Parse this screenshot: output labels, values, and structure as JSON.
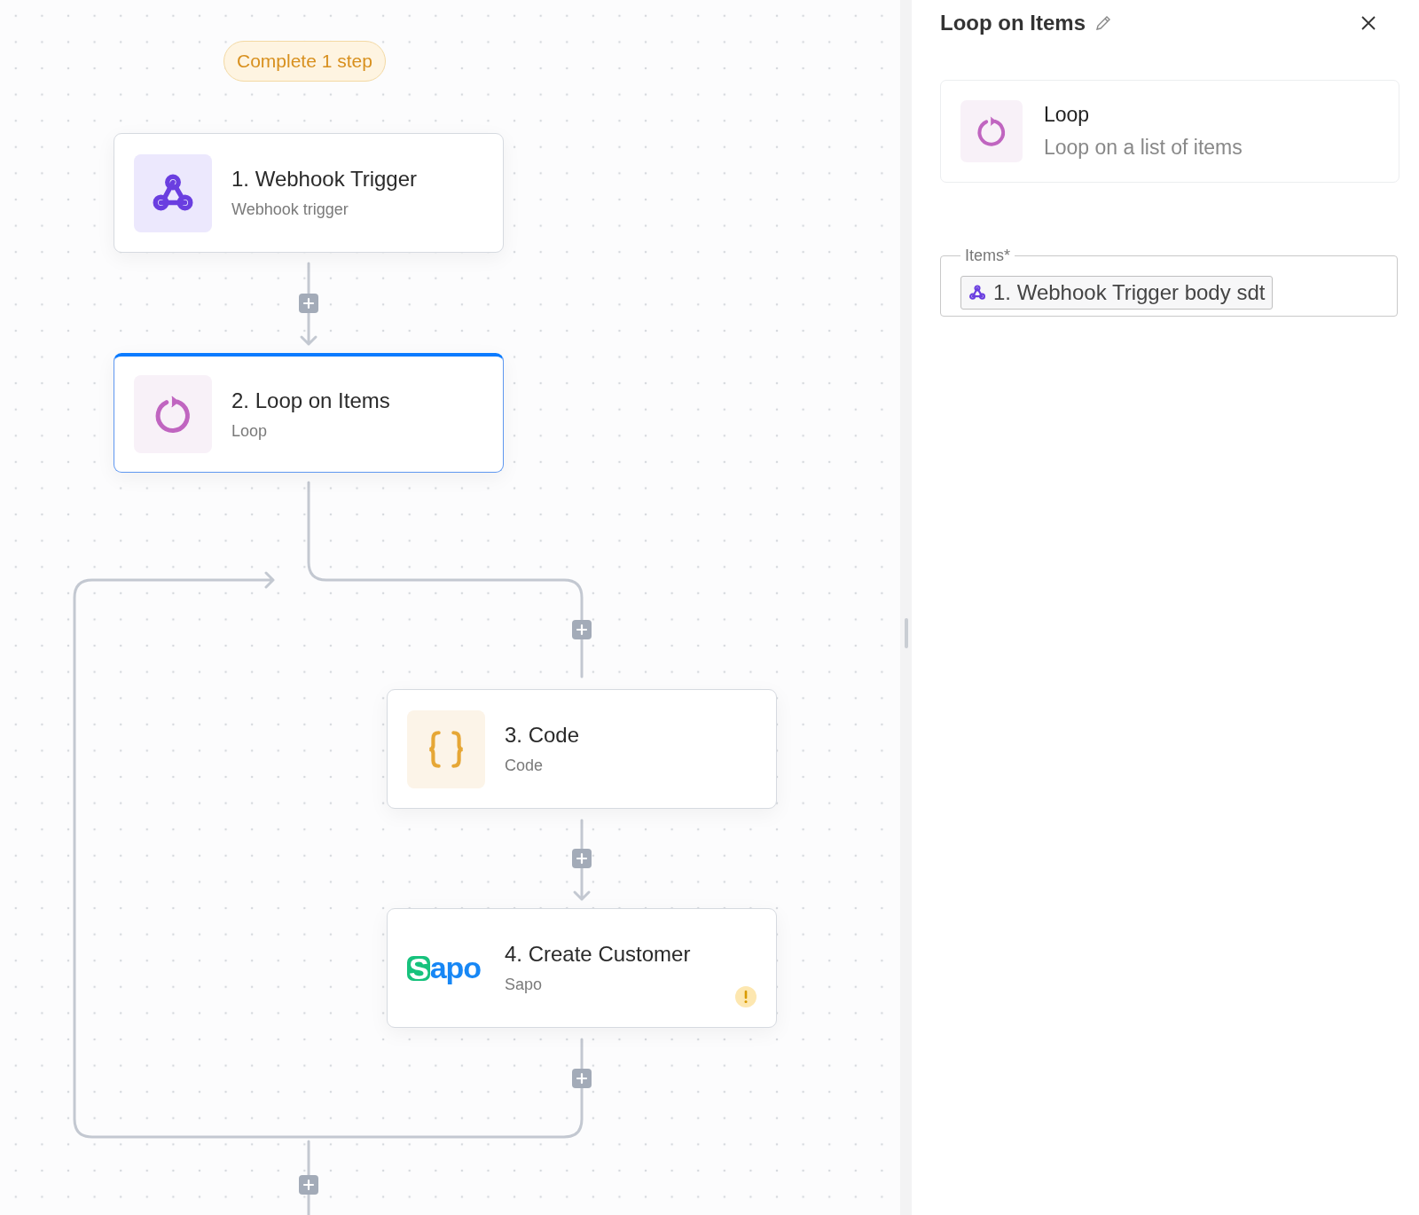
{
  "canvas": {
    "status_badge": "Complete 1 step",
    "steps": [
      {
        "kind": "webhook",
        "title": "1. Webhook Trigger",
        "subtitle": "Webhook trigger",
        "selected": false,
        "warning": false
      },
      {
        "kind": "loop",
        "title": "2. Loop on Items",
        "subtitle": "Loop",
        "selected": true,
        "warning": false
      },
      {
        "kind": "code",
        "title": "3. Code",
        "subtitle": "Code",
        "selected": false,
        "warning": false
      },
      {
        "kind": "logo",
        "logo_text": "Sapo",
        "title": "4. Create Customer",
        "subtitle": "Sapo",
        "selected": false,
        "warning": true
      }
    ]
  },
  "panel": {
    "title": "Loop on Items",
    "piece": {
      "kind": "loop",
      "name": "Loop",
      "description": "Loop on a list of items"
    },
    "field": {
      "label": "Items*",
      "chip": {
        "kind": "webhook",
        "text": "1. Webhook Trigger body sdt"
      }
    }
  }
}
